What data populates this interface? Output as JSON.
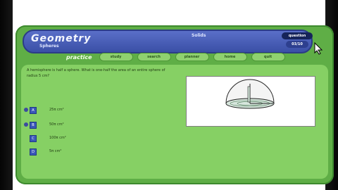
{
  "header": {
    "title": "Geometry",
    "subtitle": "Spheres",
    "section": "Solids",
    "question_label": "question",
    "question_count": "03/10"
  },
  "nav": {
    "mode": "practice",
    "tabs": [
      "study",
      "search",
      "planner",
      "home",
      "quit"
    ]
  },
  "question": {
    "text": "A hemisphere is half a sphere. What is one-half the area of an entire sphere of radius 5 cm?"
  },
  "answers": [
    {
      "key": "A",
      "text": "25π cm²"
    },
    {
      "key": "B",
      "text": "50π cm²"
    },
    {
      "key": "C",
      "text": "100π cm²"
    },
    {
      "key": "D",
      "text": "5π cm²"
    }
  ],
  "figure": {
    "icon": "hemisphere-diagram-icon"
  },
  "colors": {
    "frame": "#5fae46",
    "content": "#86d064",
    "title_bar": "#3a4fa6",
    "tab": "#8fd16f"
  }
}
